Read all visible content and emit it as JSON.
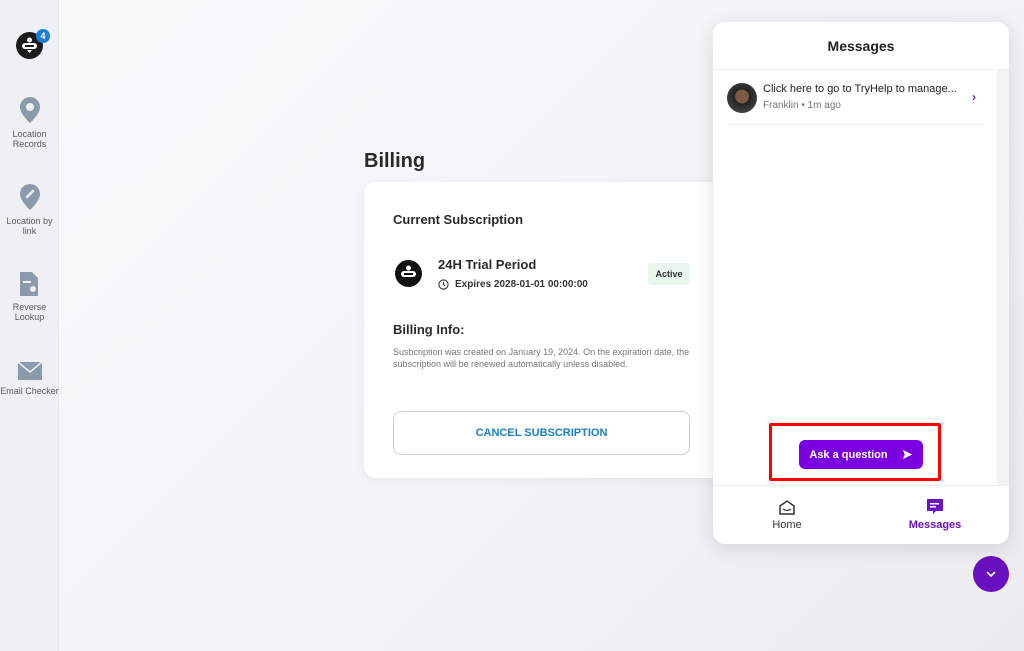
{
  "sidebar": {
    "badge_count": "4",
    "items": [
      {
        "label": "Location Records",
        "icon": "map-pin-icon"
      },
      {
        "label": "Location by link",
        "icon": "link-pin-icon"
      },
      {
        "label": "Reverse Lookup",
        "icon": "document-search-icon"
      },
      {
        "label": "Email Checker",
        "icon": "envelope-icon"
      }
    ]
  },
  "page": {
    "title": "Billing"
  },
  "subscription": {
    "heading": "Current Subscription",
    "plan": "24H Trial Period",
    "expires": "Expires 2028-01-01 00:00:00",
    "status": "Active",
    "billing_heading": "Billing Info:",
    "billing_text": "Susbcription was created on January 19, 2024. On the expiration date, the subscription will be renewed automatically unless disabled.",
    "cancel_label": "CANCEL SUBSCRIPTION"
  },
  "chat": {
    "title": "Messages",
    "message": {
      "text": "Click here to go to TryHelp to manage...",
      "author": "Franklin",
      "time": "1m ago",
      "meta": "Franklin • 1m ago"
    },
    "ask_label": "Ask a question",
    "tabs": [
      {
        "label": "Home"
      },
      {
        "label": "Messages"
      }
    ]
  },
  "colors": {
    "accent": "#7b00e0",
    "link": "#1a7fc1"
  }
}
